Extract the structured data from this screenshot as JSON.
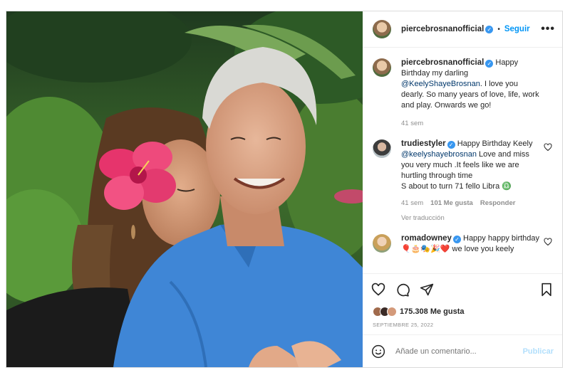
{
  "post": {
    "username": "piercebrosnanofficial",
    "follow_label": "Seguir",
    "more_label": "•••",
    "separator": "•"
  },
  "comments": [
    {
      "username": "piercebrosnanofficial",
      "text_before": "Happy Birthday my darling ",
      "mention": "@KeelyShayeBrosnan",
      "text_after": ". I love you dearly. So many years of love, life, work and play. Onwards we go!",
      "time": "41 sem"
    },
    {
      "username": "trudiestyler",
      "text_before": "Happy Birthday Keely ",
      "mention": "@keelyshayebrosnan",
      "text_after": " Love and miss you very much .It feels like we are hurtling through time",
      "text_line2": "S about to turn 71 fello Libra ♎",
      "time": "41 sem",
      "likes": "101 Me gusta",
      "reply_label": "Responder",
      "translation_label": "Ver traducción"
    },
    {
      "username": "romadowney",
      "text": "Happy happy birthday 🎈🎂🎭🎉❤️ we love you keely"
    }
  ],
  "likes": {
    "count_label": "175.308 Me gusta"
  },
  "date_label": "SEPTIEMBRE 25, 2022",
  "add_comment": {
    "placeholder": "Añade un comentario...",
    "publish_label": "Publicar"
  },
  "icons": [
    "heart-icon",
    "comment-icon",
    "share-icon",
    "bookmark-icon",
    "emoji-icon",
    "verified-icon"
  ],
  "colors": {
    "accent": "#0095f6",
    "verified": "#3897f0",
    "muted": "#8e8e8e"
  }
}
